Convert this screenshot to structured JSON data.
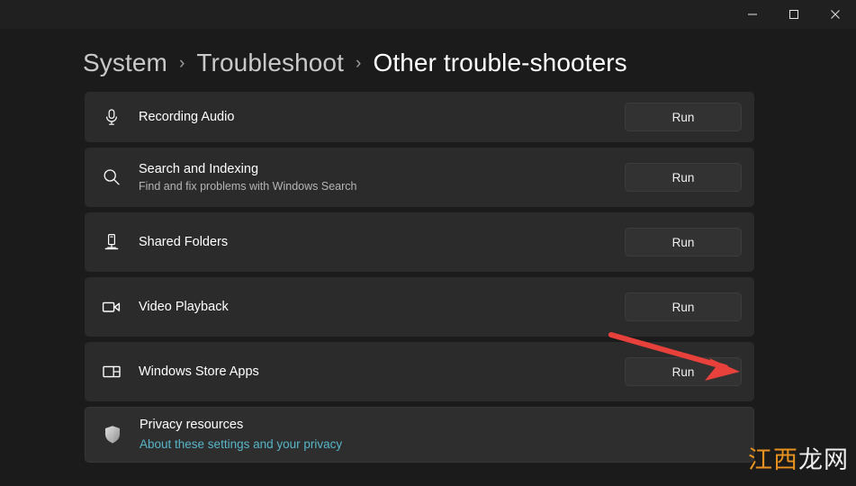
{
  "window": {
    "controls": [
      {
        "name": "minimize",
        "label": "—"
      },
      {
        "name": "maximize",
        "label": "□"
      },
      {
        "name": "close",
        "label": "✕"
      }
    ]
  },
  "breadcrumb": {
    "separator": "›",
    "items": [
      {
        "label": "System",
        "current": false
      },
      {
        "label": "Troubleshoot",
        "current": false
      },
      {
        "label": "Other trouble-shooters",
        "current": true
      }
    ]
  },
  "search": {
    "placeholder": "",
    "icon": "search-icon"
  },
  "troubleshooters": [
    {
      "id": "recording-audio",
      "icon": "microphone-icon",
      "title": "Recording Audio",
      "subtitle": "",
      "action": "Run"
    },
    {
      "id": "search-and-indexing",
      "icon": "search-icon",
      "title": "Search and Indexing",
      "subtitle": "Find and fix problems with Windows Search",
      "action": "Run"
    },
    {
      "id": "shared-folders",
      "icon": "server-icon",
      "title": "Shared Folders",
      "subtitle": "",
      "action": "Run"
    },
    {
      "id": "video-playback",
      "icon": "video-camera-icon",
      "title": "Video Playback",
      "subtitle": "",
      "action": "Run"
    },
    {
      "id": "windows-store-apps",
      "icon": "app-window-icon",
      "title": "Windows Store Apps",
      "subtitle": "",
      "action": "Run"
    }
  ],
  "privacy": {
    "icon": "shield-icon",
    "title": "Privacy resources",
    "link": "About these settings and your privacy"
  },
  "annotation": {
    "type": "arrow",
    "color": "#e8403a",
    "points": "from (678,372) to (818,413)",
    "target": "windows-store-apps-run-button"
  },
  "watermark": {
    "part1": "江西",
    "part2": "龙网",
    "color1": "#e8921f",
    "color2": "#efefef"
  },
  "colors": {
    "window_background": "#1b1b1b",
    "titlebar": "#202020",
    "card": "#2b2b2b",
    "card_privacy": "#2e2e2e",
    "button": "#323232",
    "link": "#57b6c9",
    "accent_red": "#e8403a"
  }
}
